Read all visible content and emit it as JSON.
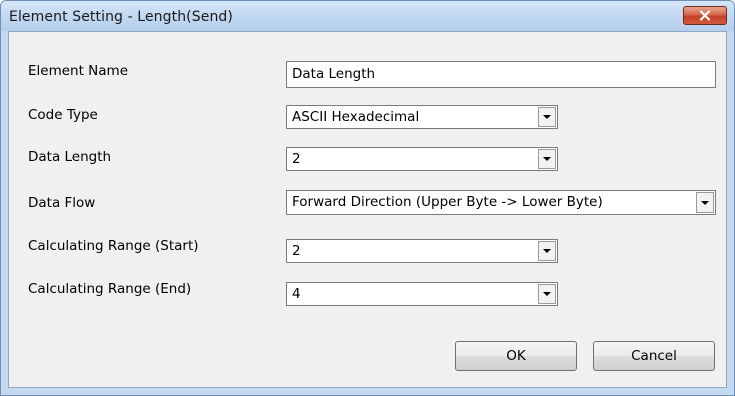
{
  "window": {
    "title": "Element Setting - Length(Send)",
    "close_icon": "close-icon"
  },
  "form": {
    "element_name_label": "Element Name",
    "element_name_value": "Data Length",
    "code_type_label": "Code Type",
    "code_type_value": "ASCII Hexadecimal",
    "data_length_label": "Data Length",
    "data_length_value": "2",
    "data_flow_label": "Data Flow",
    "data_flow_value": "Forward Direction (Upper Byte -> Lower Byte)",
    "range_start_label": "Calculating Range (Start)",
    "range_start_value": "2",
    "range_end_label": "Calculating Range (End)",
    "range_end_value": "4"
  },
  "buttons": {
    "ok": "OK",
    "cancel": "Cancel"
  },
  "colors": {
    "titlebar": "#c2d8f1",
    "client": "#f0f0f0",
    "close": "#c2402a"
  }
}
